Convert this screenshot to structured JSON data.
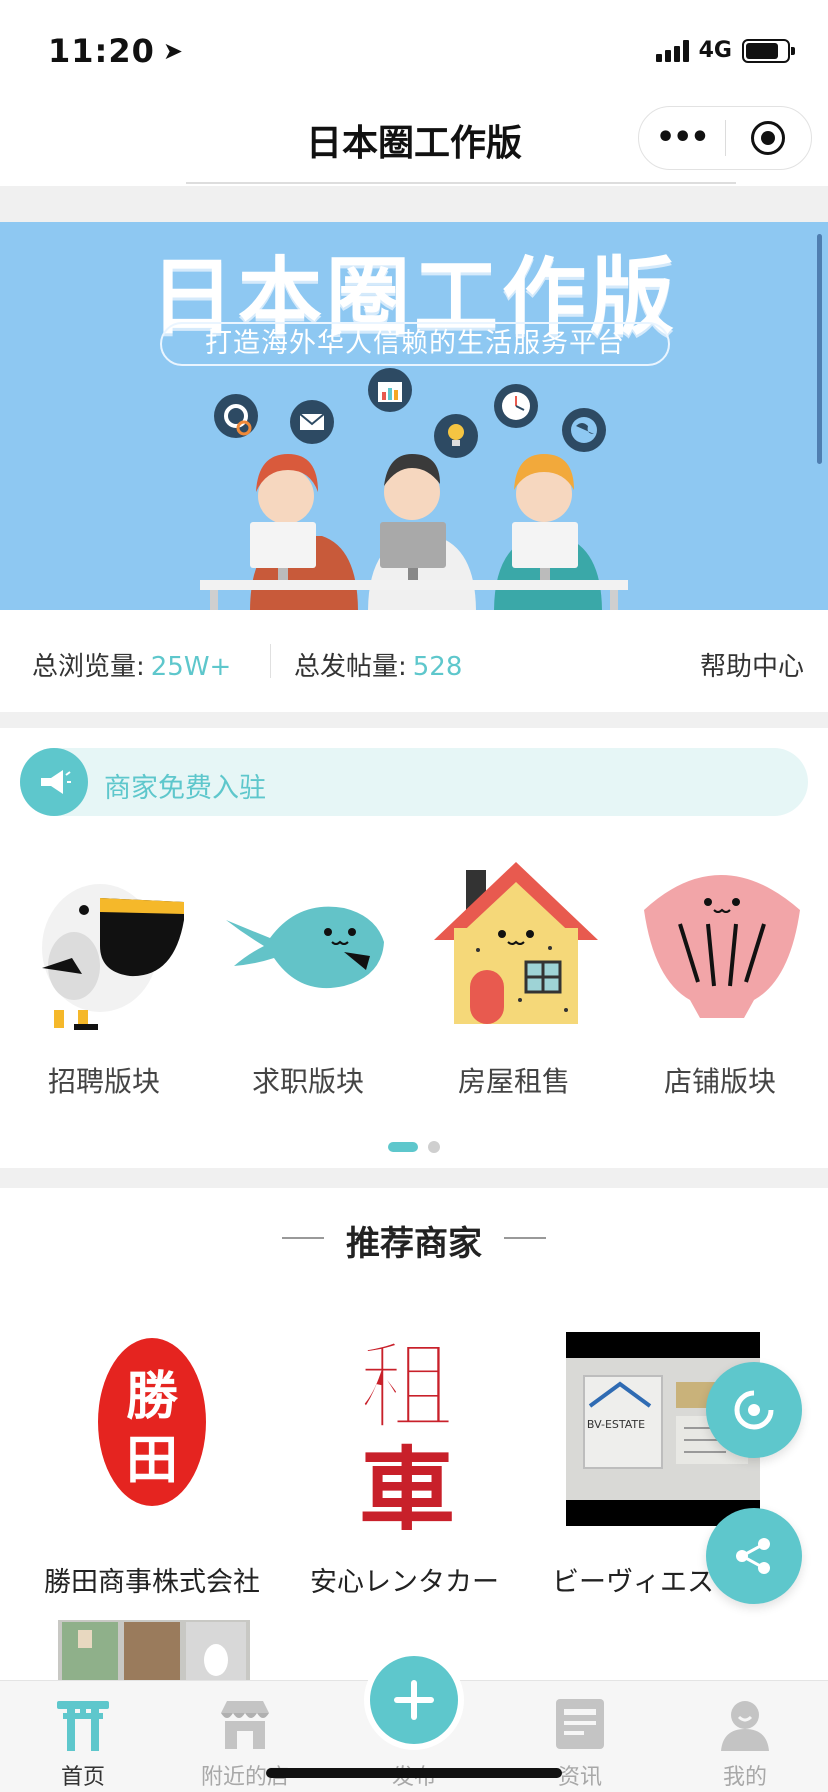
{
  "status_bar": {
    "time": "11:20",
    "network": "4G"
  },
  "header": {
    "title": "日本圈工作版",
    "more_label": "•••"
  },
  "banner": {
    "title": "日本圈工作版",
    "subtitle": "打造海外华人信赖的生活服务平台"
  },
  "stats": {
    "views_label": "总浏览量:",
    "views_value": "25W+",
    "posts_label": "总发帖量:",
    "posts_value": "528",
    "help_label": "帮助中心"
  },
  "notice": {
    "text": "商家免费入驻"
  },
  "categories": [
    {
      "label": "招聘版块",
      "icon": "pelican-icon"
    },
    {
      "label": "求职版块",
      "icon": "whale-icon"
    },
    {
      "label": "房屋租售",
      "icon": "house-icon"
    },
    {
      "label": "店铺版块",
      "icon": "shell-icon"
    }
  ],
  "pager": {
    "pages": 2,
    "active": 1
  },
  "recommended": {
    "title": "推荐商家",
    "merchants": [
      {
        "name": "勝田商事株式会社",
        "logo_text": "勝田"
      },
      {
        "name": "安心レンタカー",
        "logo_text": "租車"
      },
      {
        "name": "ビーヴィエス",
        "logo_text": "BV-ESTATE"
      }
    ]
  },
  "tabbar": [
    {
      "label": "首页",
      "icon": "torii-icon",
      "active": true
    },
    {
      "label": "附近的店",
      "icon": "shop-icon",
      "active": false
    },
    {
      "label": "发布",
      "icon": "plus-icon",
      "active": false
    },
    {
      "label": "资讯",
      "icon": "news-icon",
      "active": false
    },
    {
      "label": "我的",
      "icon": "user-icon",
      "active": false
    }
  ],
  "colors": {
    "accent": "#5ec7cc",
    "banner_bg": "#8ec8f2",
    "notice_bg": "#e6f6f6",
    "stamp_red": "#e52420",
    "text_dark": "#222222"
  }
}
